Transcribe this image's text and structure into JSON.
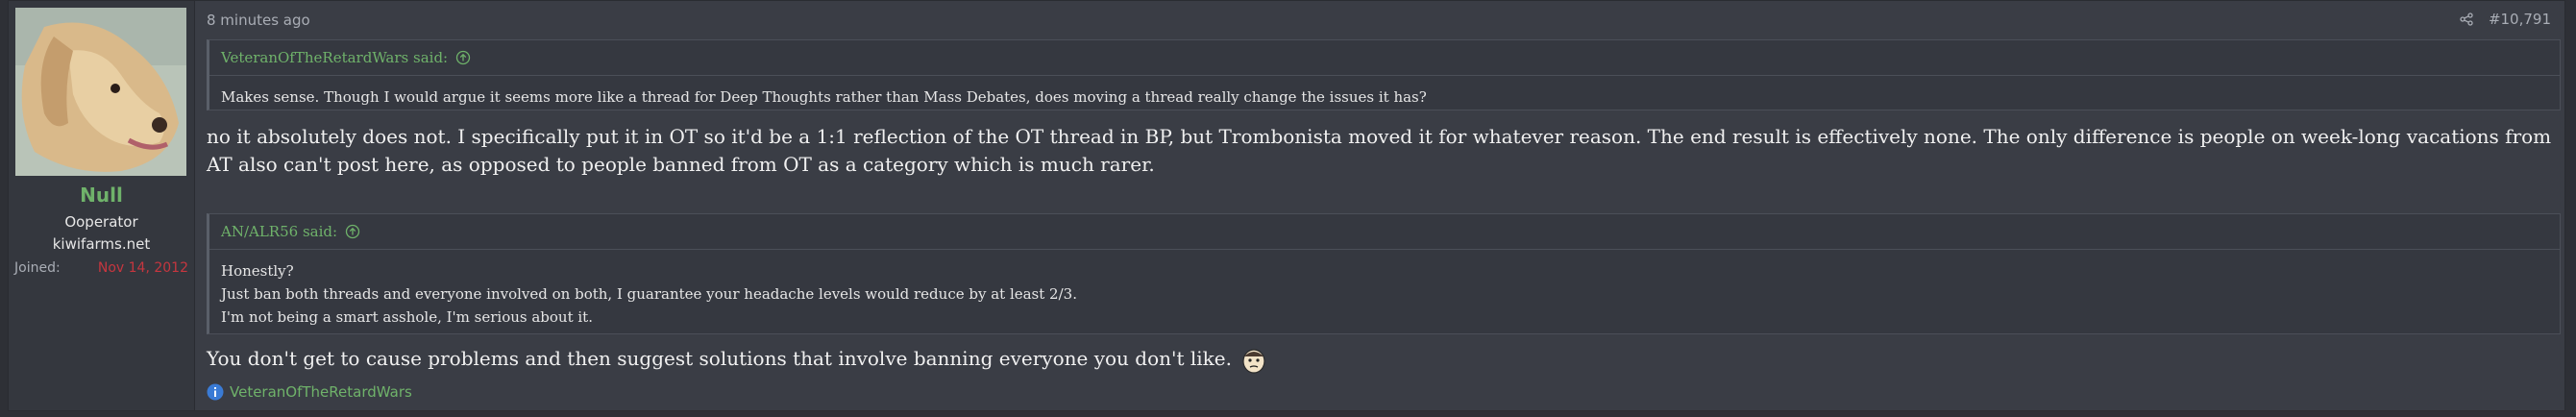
{
  "user": {
    "name": "Null",
    "title": "Ooperator",
    "site": "kiwifarms.net",
    "joined_label": "Joined:",
    "joined_date": "Nov 14, 2012"
  },
  "post": {
    "time": "8 minutes ago",
    "number": "#10,791",
    "quote1": {
      "author_said": "VeteranOfTheRetardWars said:",
      "text": "Makes sense. Though I would argue it seems more like a thread for Deep Thoughts rather than Mass Debates, does moving a thread really change the issues it has?"
    },
    "reply1": "no it absolutely does not. I specifically put it in OT so it'd be a 1:1 reflection of the OT thread in BP, but Trombonista moved it for whatever reason. The end result is effectively none. The only difference is people on week-long vacations from AT also can't post here, as opposed to people banned from OT as a category which is much rarer.",
    "quote2": {
      "author_said": "AN/ALR56 said:",
      "line1": "Honestly?",
      "line2": "Just ban both threads and everyone involved on both, I guarantee your headache levels would reduce by at least 2/3.",
      "line3": "I'm not being a smart asshole, I'm serious about it."
    },
    "reply2": "You don't get to cause problems and then suggest solutions that involve banning everyone you don't like.",
    "reaction_user": "VeteranOfTheRetardWars"
  },
  "colors": {
    "username": "#6fb26a",
    "joined_date": "#c6363f",
    "background": "#3a3d45"
  },
  "icons": [
    "share-icon",
    "arrow-up-circle-icon",
    "info-icon",
    "emoji-icon"
  ]
}
